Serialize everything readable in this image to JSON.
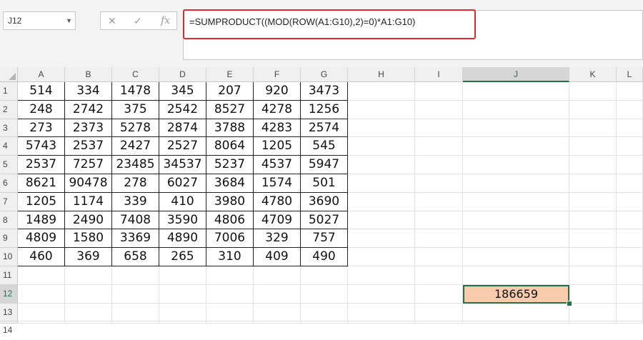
{
  "name_box": {
    "value": "J12"
  },
  "formula_bar": {
    "formula": "=SUMPRODUCT((MOD(ROW(A1:G10),2)=0)*A1:G10)"
  },
  "icons": {
    "cancel": "x-icon",
    "enter": "check-icon",
    "function": "fx-icon"
  },
  "labels": {
    "fx": "fx"
  },
  "columns": [
    "A",
    "B",
    "C",
    "D",
    "E",
    "F",
    "G",
    "H",
    "I",
    "J",
    "K",
    "L"
  ],
  "rows": [
    "1",
    "2",
    "3",
    "4",
    "5",
    "6",
    "7",
    "8",
    "9",
    "10",
    "11",
    "12",
    "13",
    "14"
  ],
  "selected": {
    "column": "J",
    "row": "12"
  },
  "data": [
    [
      "514",
      "334",
      "1478",
      "345",
      "207",
      "920",
      "3473"
    ],
    [
      "248",
      "2742",
      "375",
      "2542",
      "8527",
      "4278",
      "1256"
    ],
    [
      "273",
      "2373",
      "5278",
      "2874",
      "3788",
      "4283",
      "2574"
    ],
    [
      "5743",
      "2537",
      "2427",
      "2527",
      "8064",
      "1205",
      "545"
    ],
    [
      "2537",
      "7257",
      "23485",
      "34537",
      "5237",
      "4537",
      "5947"
    ],
    [
      "8621",
      "90478",
      "278",
      "6027",
      "3684",
      "1574",
      "501"
    ],
    [
      "1205",
      "1174",
      "339",
      "410",
      "3980",
      "4780",
      "3690"
    ],
    [
      "1489",
      "2490",
      "7408",
      "3590",
      "4806",
      "4709",
      "5027"
    ],
    [
      "4809",
      "1580",
      "3369",
      "4890",
      "7006",
      "329",
      "757"
    ],
    [
      "460",
      "369",
      "658",
      "265",
      "310",
      "409",
      "490"
    ]
  ],
  "result": {
    "cell": "J12",
    "value": "186659"
  },
  "colors": {
    "accent": "#217346",
    "highlight": "#f8cbad",
    "annotation": "#e8272b"
  }
}
